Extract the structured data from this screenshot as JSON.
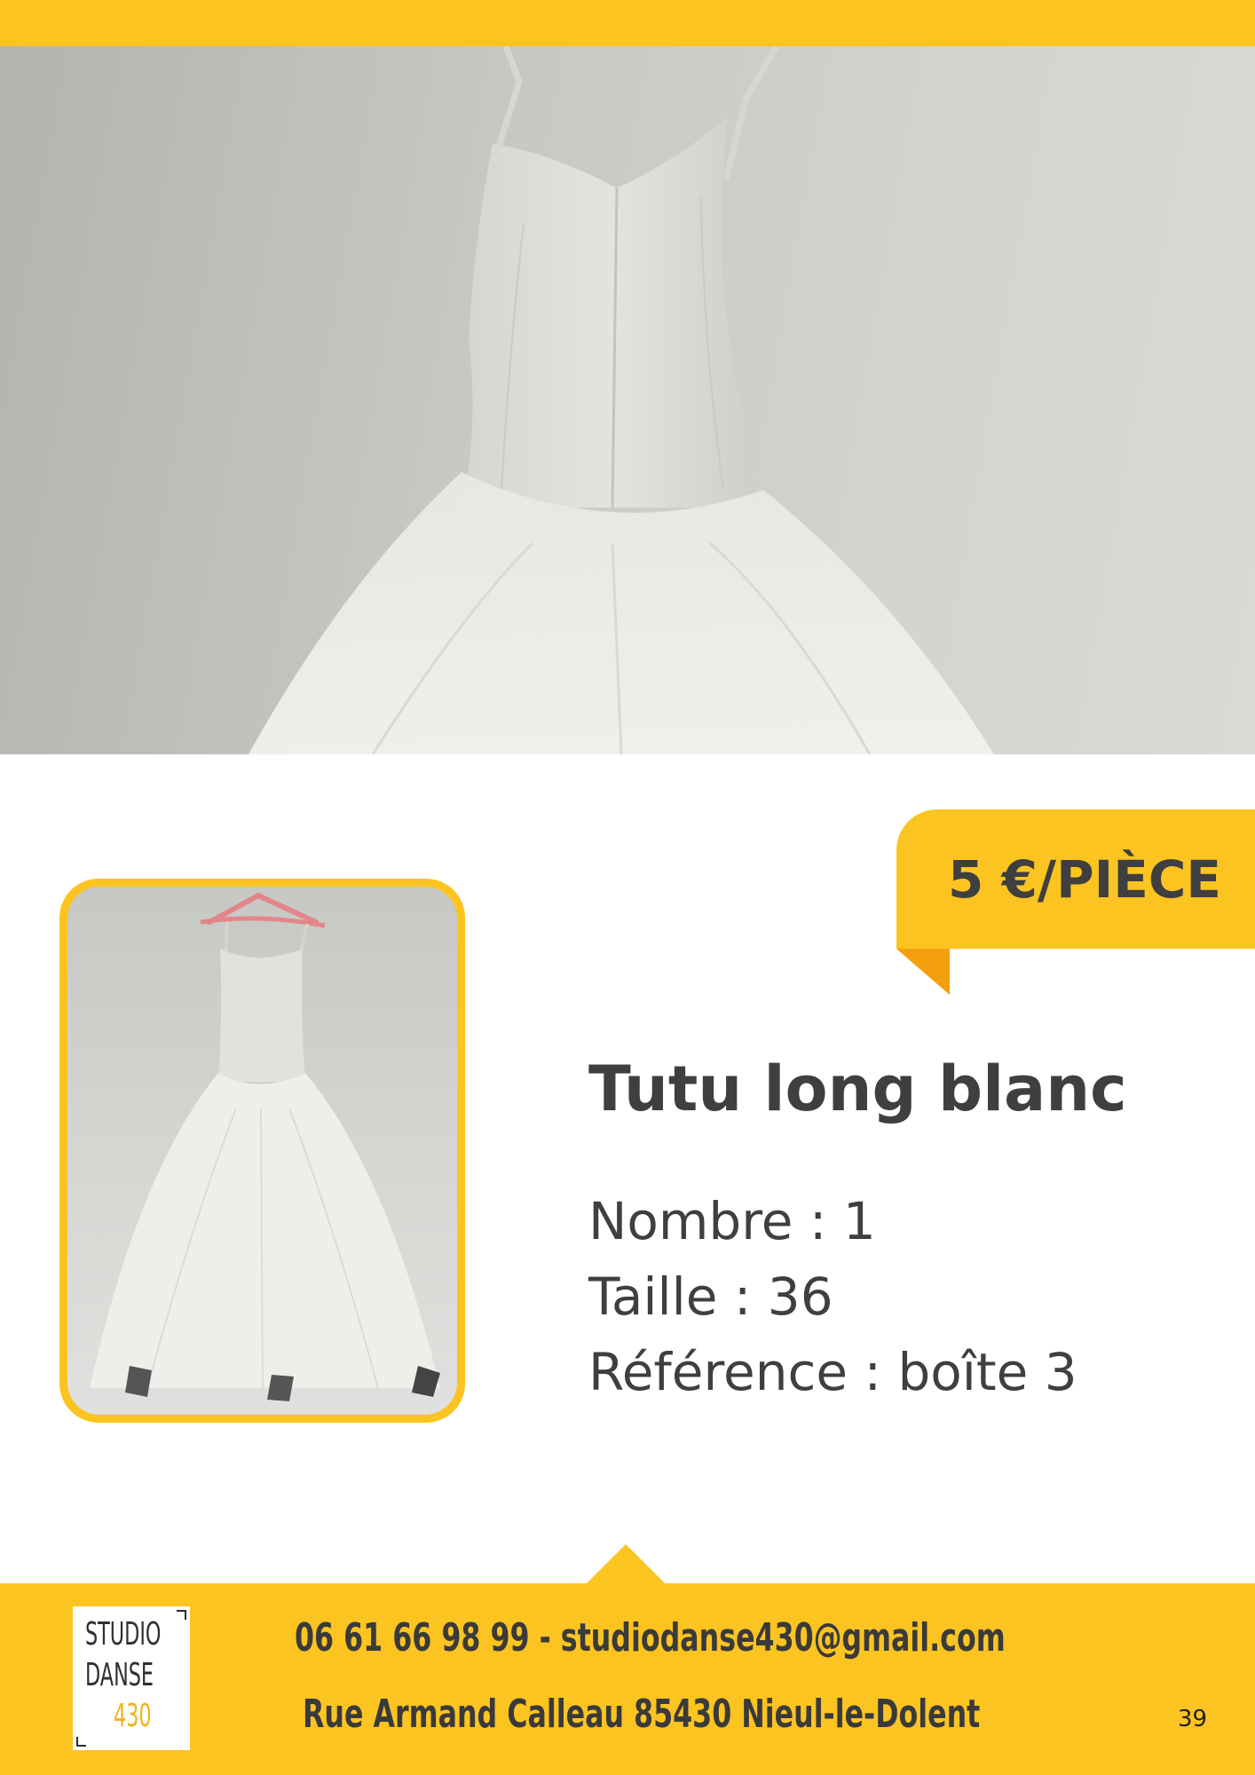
{
  "colors": {
    "accent": "#fcc421",
    "accent_dark": "#f59f0f",
    "text": "#3f3f3f"
  },
  "hero_image": {
    "icon": "white-ballet-dress-photo"
  },
  "thumbnail_image": {
    "icon": "tutu-on-hanger-photo"
  },
  "price": {
    "label": "5 €/PIÈCE"
  },
  "product": {
    "title": "Tutu long blanc",
    "details": [
      "Nombre : 1",
      "Taille : 36",
      "Référence : boîte 3"
    ]
  },
  "footer": {
    "logo": {
      "line1": "STUDIO",
      "line2": "DANSE",
      "line3": "430"
    },
    "contact_line": "06 61 66 98 99 - studiodanse430@gmail.com",
    "address_line": "Rue Armand Calleau 85430 Nieul-le-Dolent",
    "page_number": "39"
  }
}
